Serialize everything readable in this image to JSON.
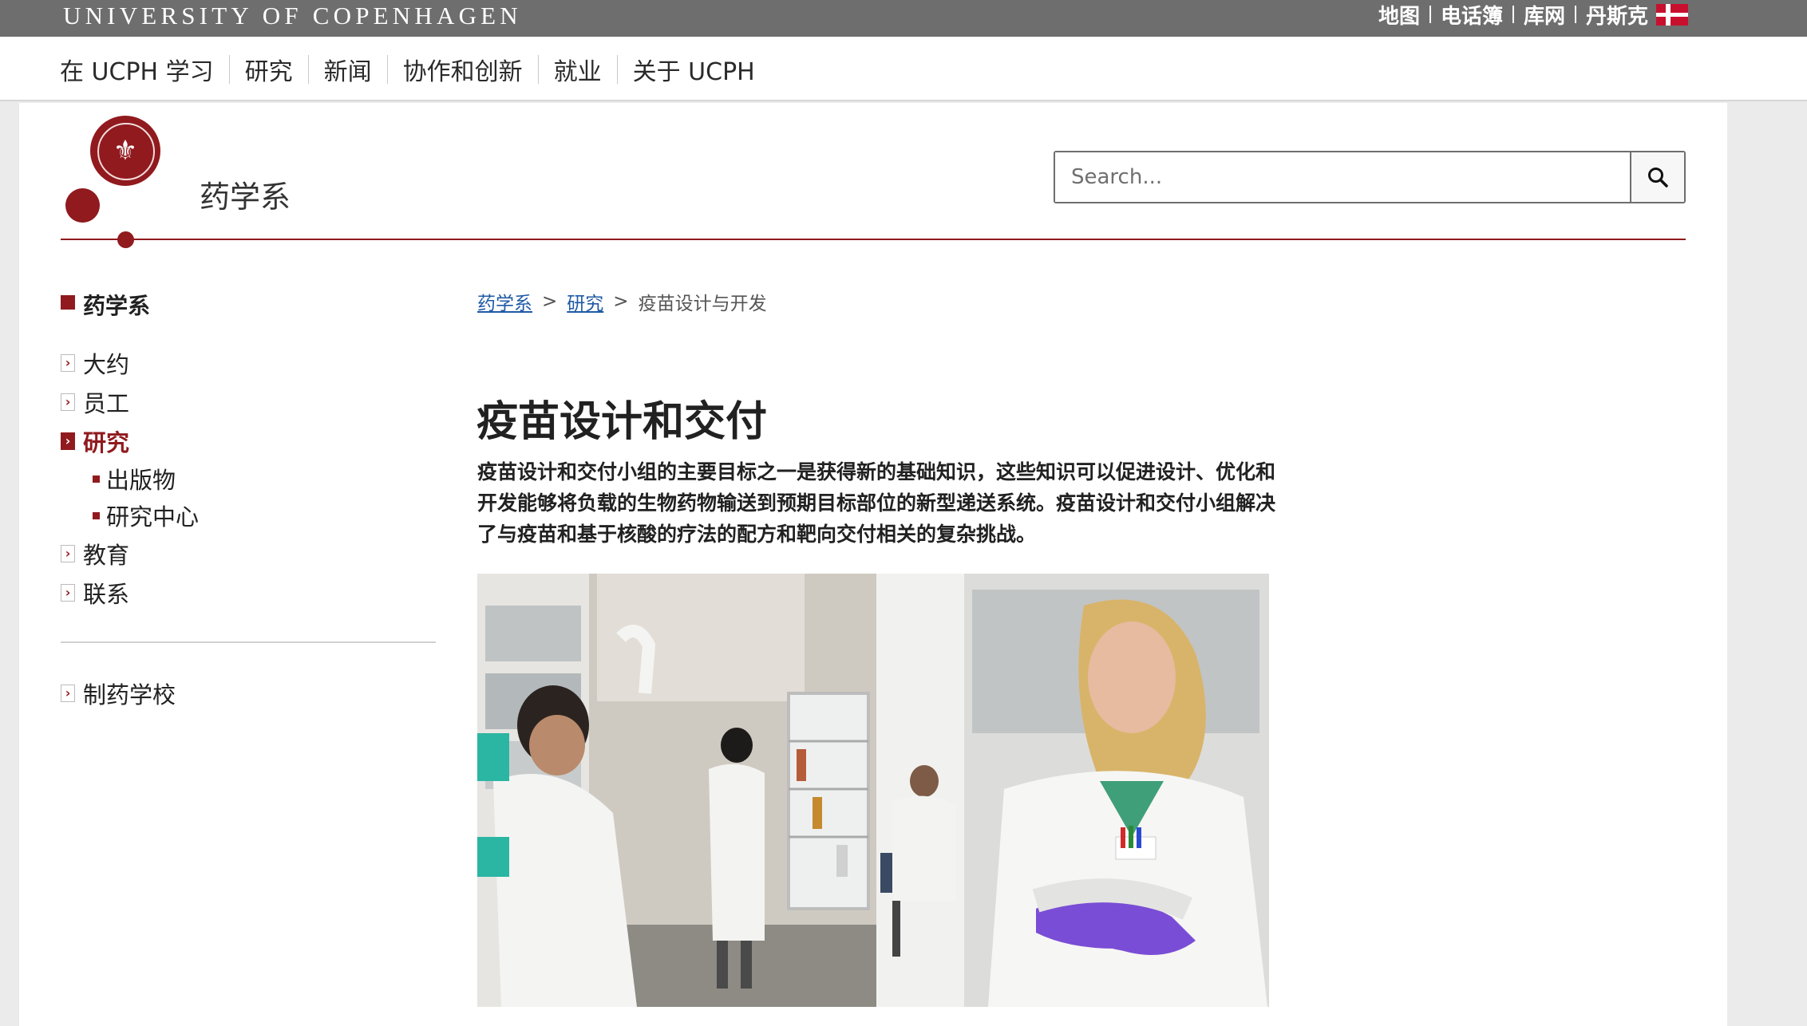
{
  "topbar": {
    "university_name": "UNIVERSITY OF COPENHAGEN",
    "links": [
      "地图",
      "电话簿",
      "库网",
      "丹斯克"
    ],
    "flag_icon": "danish-flag-icon"
  },
  "mainnav": {
    "items": [
      "在 UCPH 学习",
      "研究",
      "新闻",
      "协作和创新",
      "就业",
      "关于 UCPH"
    ]
  },
  "header": {
    "department": "药学系",
    "search_placeholder": "Search...",
    "search_icon": "search-icon",
    "accent_color": "#901a1e"
  },
  "sidebar": {
    "heading": "药学系",
    "items": [
      {
        "label": "大约"
      },
      {
        "label": "员工"
      },
      {
        "label": "研究"
      },
      {
        "label": "出版物"
      },
      {
        "label": "研究中心"
      },
      {
        "label": "教育"
      },
      {
        "label": "联系"
      }
    ],
    "extra": "制药学校"
  },
  "breadcrumb": {
    "items": [
      "药学系",
      "研究",
      "疫苗设计与开发"
    ],
    "separator": ">"
  },
  "article": {
    "title": "疫苗设计和交付",
    "lead": "疫苗设计和交付小组的主要目标之一是获得新的基础知识，这些知识可以促进设计、优化和开发能够将负载的生物药物输送到预期目标部位的新型递送系统。疫苗设计和交付小组解决了与疫苗和基于核酸的疗法的配方和靶向交付相关的复杂挑战。"
  }
}
